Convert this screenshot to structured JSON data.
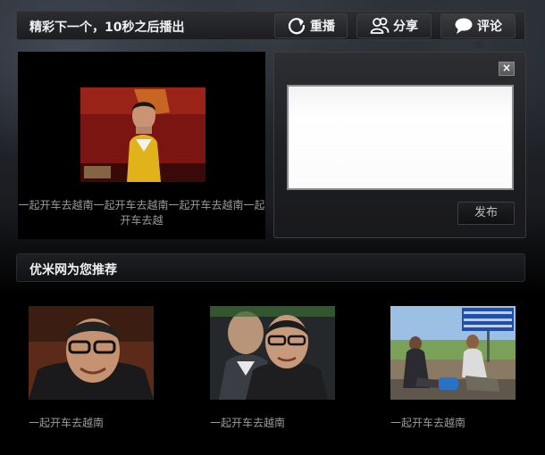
{
  "header": {
    "title": "精彩下一个，10秒之后播出",
    "buttons": {
      "replay": {
        "label": "重播",
        "icon": "replay-icon"
      },
      "share": {
        "label": "分享",
        "icon": "share-icon"
      },
      "comment": {
        "label": "评论",
        "icon": "speech-bubble-icon"
      }
    }
  },
  "next_video": {
    "caption": "一起开车去越南一起开车去越南一起开车去越南一起开车去越"
  },
  "comment_box": {
    "close_label": "×",
    "text": "",
    "publish_label": "发布"
  },
  "recommend": {
    "title": "优米网为您推荐",
    "items": [
      {
        "caption": "一起开车去越南"
      },
      {
        "caption": "一起开车去越南"
      },
      {
        "caption": "一起开车去越南"
      }
    ]
  }
}
